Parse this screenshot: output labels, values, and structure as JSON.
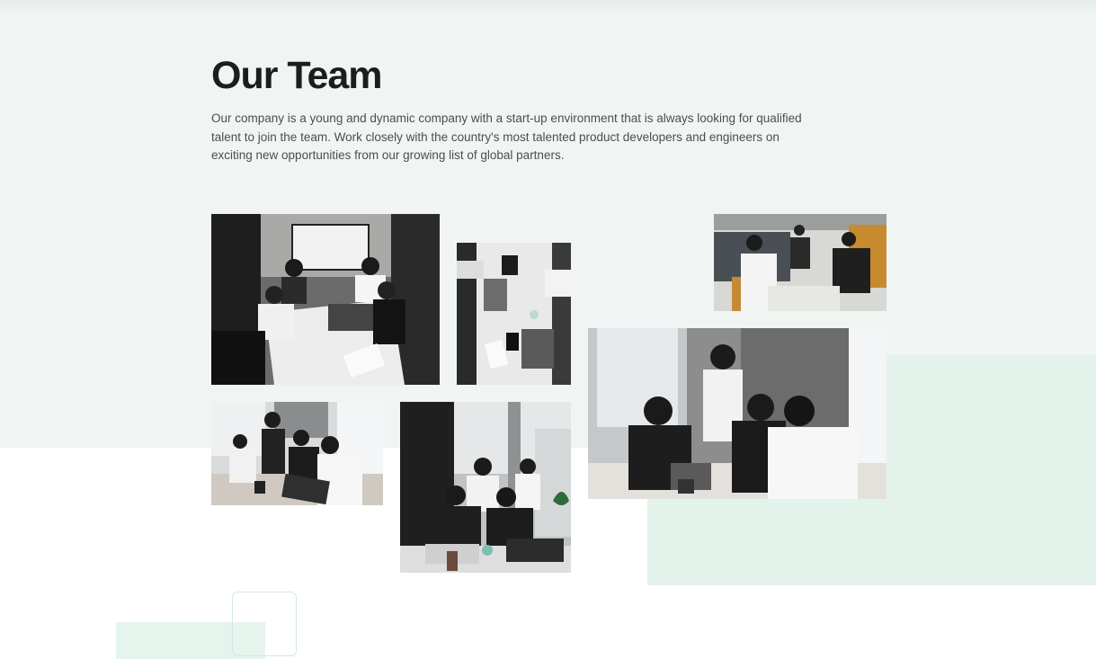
{
  "section": {
    "title": "Our Team",
    "description": "Our company is a young and dynamic company with a start-up environment that is always looking for qualified talent to join the team. Work closely with the country's most talented product developers and engineers on exciting new opportunities from our growing list of global partners."
  },
  "colors": {
    "band_background": "#f0f5f4",
    "accent_green": "#e4f2ec",
    "title_text": "#1d1d1f",
    "body_text": "#4a4d52"
  }
}
